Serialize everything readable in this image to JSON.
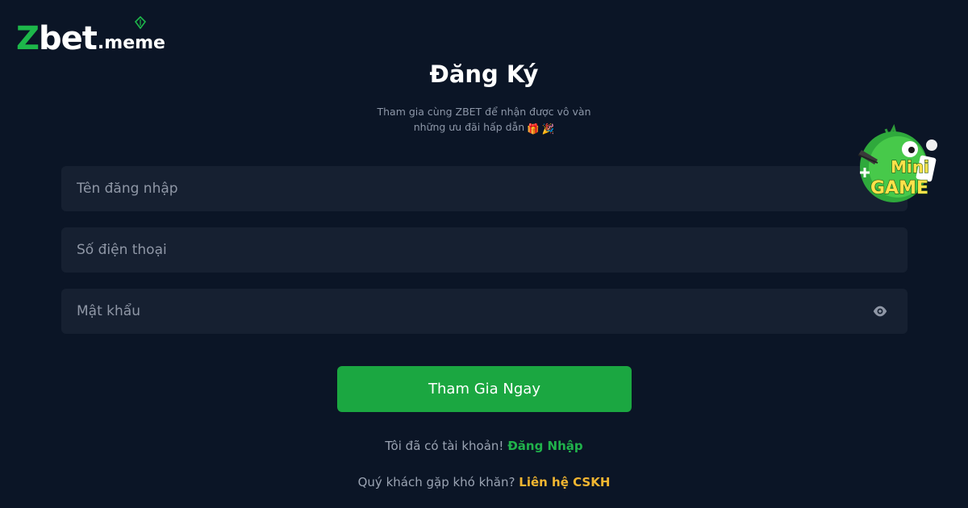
{
  "brand": {
    "logo_main_z": "Z",
    "logo_main_rest": "bet",
    "logo_suffix": ".meme"
  },
  "register": {
    "title": "Đăng Ký",
    "subtitle_line1": "Tham gia cùng ZBET để nhận được vô vàn",
    "subtitle_line2": "những ưu đãi hấp dẫn",
    "emoji_gift": "🎁",
    "emoji_party": "🎉",
    "username_placeholder": "Tên đăng nhập",
    "phone_placeholder": "Số điện thoại",
    "password_placeholder": "Mật khẩu",
    "submit_label": "Tham Gia Ngay",
    "have_account_text": "Tôi đã có tài khoản!",
    "login_link": "Đăng Nhập",
    "difficulty_text": "Quý khách gặp khó khăn?",
    "support_link": "Liên hệ CSKH"
  },
  "minigame": {
    "label_top": "Mini",
    "label_bottom": "GAME"
  },
  "colors": {
    "background": "#0b1526",
    "field": "#162031",
    "accent_green": "#1ba741",
    "link_green": "#20b24b",
    "link_yellow": "#f2b631"
  },
  "icons": {
    "eye": "eye-icon",
    "leaf": "leaf-icon",
    "minigame": "minigame-icon"
  }
}
